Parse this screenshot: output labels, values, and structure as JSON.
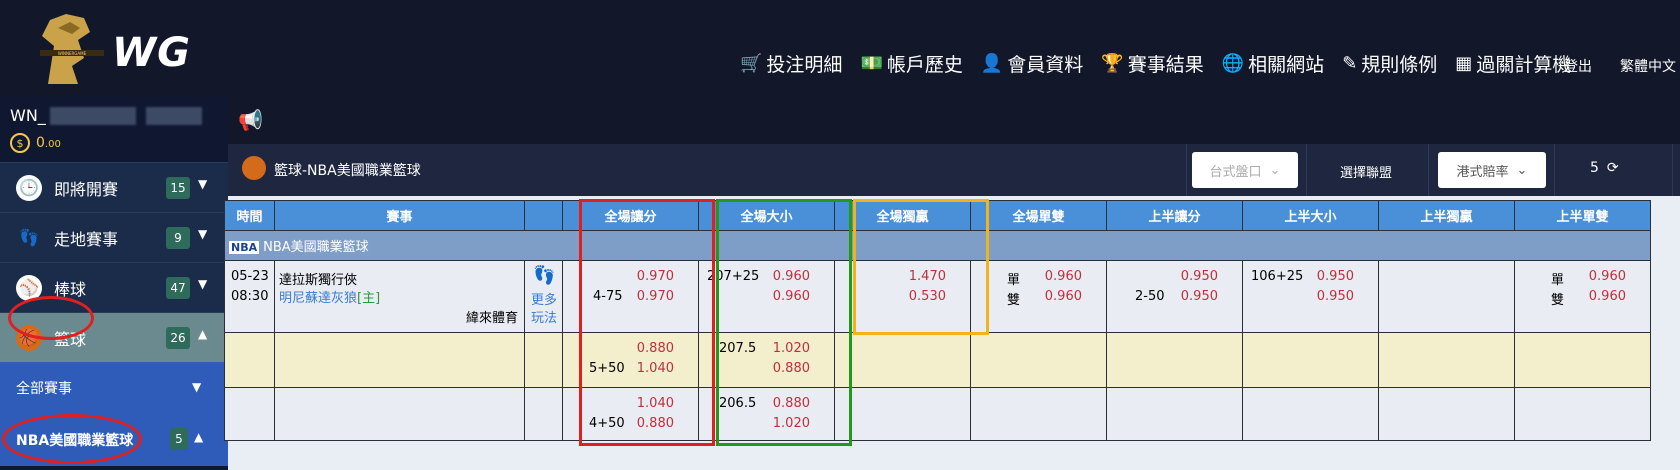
{
  "header": {
    "logo_text": "WG",
    "nav": [
      {
        "icon": "cart-icon",
        "glyph": "🛒",
        "label": "投注明細"
      },
      {
        "icon": "money-icon",
        "glyph": "💵",
        "label": "帳戶歷史"
      },
      {
        "icon": "user-icon",
        "glyph": "👤",
        "label": "會員資料"
      },
      {
        "icon": "trophy-icon",
        "glyph": "🏆",
        "label": "賽事結果"
      },
      {
        "icon": "globe-icon",
        "glyph": "🌐",
        "label": "相關網站"
      },
      {
        "icon": "pencil-icon",
        "glyph": "✎",
        "label": "規則條例"
      },
      {
        "icon": "calculator-icon",
        "glyph": "▦",
        "label": "過關計算機"
      }
    ],
    "login": "登出",
    "language": "繁體中文"
  },
  "user": {
    "name_prefix": "WN_",
    "balance": "0",
    "balance_decimal": ".00"
  },
  "sidebar": {
    "sports": [
      {
        "label": "即將開賽",
        "count": "15",
        "icon": "clock-icon",
        "glyph": "🕒"
      },
      {
        "label": "走地賽事",
        "count": "9",
        "icon": "footprint-icon",
        "glyph": "👣"
      },
      {
        "label": "棒球",
        "count": "47",
        "icon": "baseball-icon",
        "glyph": "⚾"
      },
      {
        "label": "籃球",
        "count": "26",
        "icon": "basketball-icon",
        "glyph": "🏀"
      }
    ],
    "all_matches": "全部賽事",
    "league": {
      "label": "NBA美國職業籃球",
      "count": "5"
    }
  },
  "league_bar": {
    "title": "籃球-NBA美國職業籃球",
    "market_select": "台式盤口",
    "choose_league": "選擇聯盟",
    "odds_select": "港式賠率",
    "refresh_count": "5"
  },
  "table": {
    "headers": [
      "時間",
      "賽事",
      "",
      "全場讓分",
      "全場大小",
      "全場獨贏",
      "全場單雙",
      "上半讓分",
      "上半大小",
      "上半獨贏",
      "上半單雙"
    ],
    "league_name": "NBA美國職業籃球",
    "league_badge": "NBA",
    "match": {
      "date": "05-23",
      "time": "08:30",
      "team_home": "達拉斯獨行俠",
      "team_away": "明尼蘇達灰狼",
      "home_tag": "[主]",
      "broadcast": "緯來體育",
      "more_line1": "更多",
      "more_line2": "玩法"
    },
    "rows": [
      {
        "fh_hcap": {
          "line": "4-75",
          "top": "0.970",
          "bottom": "0.970"
        },
        "fh_ou": {
          "line": "207+25",
          "top": "0.960",
          "bottom": "0.960"
        },
        "fh_ml": {
          "top": "1.470",
          "bottom": "0.530"
        },
        "fh_oe": {
          "odd_label": "單",
          "odd": "0.960",
          "even_label": "雙",
          "even": "0.960"
        },
        "h1_hcap": {
          "line": "2-50",
          "top": "0.950",
          "bottom": "0.950"
        },
        "h1_ou": {
          "line": "106+25",
          "top": "0.950",
          "bottom": "0.950"
        },
        "h1_oe": {
          "odd_label": "單",
          "odd": "0.960",
          "even_label": "雙",
          "even": "0.960"
        }
      },
      {
        "fh_hcap": {
          "line": "5+50",
          "top": "0.880",
          "bottom": "1.040"
        },
        "fh_ou": {
          "line": "207.5",
          "top": "1.020",
          "bottom": "0.880"
        }
      },
      {
        "fh_hcap": {
          "line": "4+50",
          "top": "1.040",
          "bottom": "0.880"
        },
        "fh_ou": {
          "line": "206.5",
          "top": "0.880",
          "bottom": "1.020"
        }
      }
    ]
  },
  "colors": {
    "highlight_red": "#e02020",
    "highlight_green": "#1f9a1f",
    "highlight_yellow": "#f0b41a"
  }
}
